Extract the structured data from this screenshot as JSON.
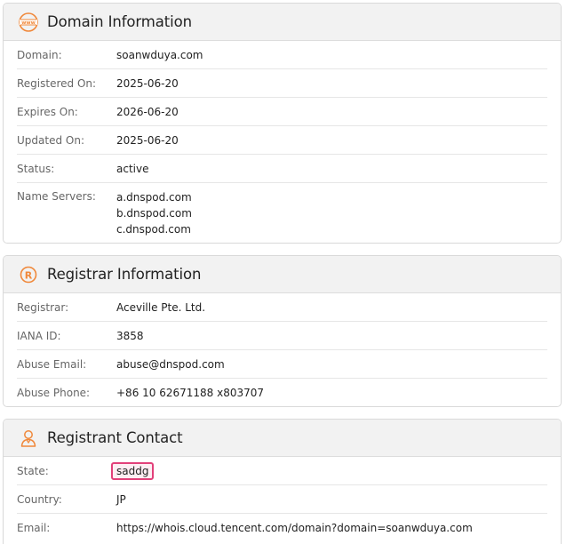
{
  "domain_info": {
    "title": "Domain Information",
    "icon": "www-globe-icon",
    "rows": {
      "domain": {
        "label": "Domain:",
        "value": "soanwduya.com"
      },
      "registered": {
        "label": "Registered On:",
        "value": "2025-06-20"
      },
      "expires": {
        "label": "Expires On:",
        "value": "2026-06-20"
      },
      "updated": {
        "label": "Updated On:",
        "value": "2025-06-20"
      },
      "status": {
        "label": "Status:",
        "value": "active"
      },
      "name_servers": {
        "label": "Name Servers:",
        "values": [
          "a.dnspod.com",
          "b.dnspod.com",
          "c.dnspod.com"
        ]
      }
    }
  },
  "registrar_info": {
    "title": "Registrar Information",
    "icon": "registered-r-icon",
    "rows": {
      "registrar": {
        "label": "Registrar:",
        "value": "Aceville Pte. Ltd."
      },
      "iana": {
        "label": "IANA ID:",
        "value": "3858"
      },
      "abuse_email": {
        "label": "Abuse Email:",
        "value": "abuse@dnspod.com"
      },
      "abuse_phone": {
        "label": "Abuse Phone:",
        "value": "+86 10 62671188 x803707"
      }
    }
  },
  "registrant_contact": {
    "title": "Registrant Contact",
    "icon": "person-icon",
    "rows": {
      "state": {
        "label": "State:",
        "value": "saddg"
      },
      "country": {
        "label": "Country:",
        "value": "JP"
      },
      "email": {
        "label": "Email:",
        "value": "https://whois.cloud.tencent.com/domain?domain=soanwduya.com"
      }
    }
  },
  "colors": {
    "accent_orange": "#f0883a",
    "highlight_border": "#e2407a"
  }
}
